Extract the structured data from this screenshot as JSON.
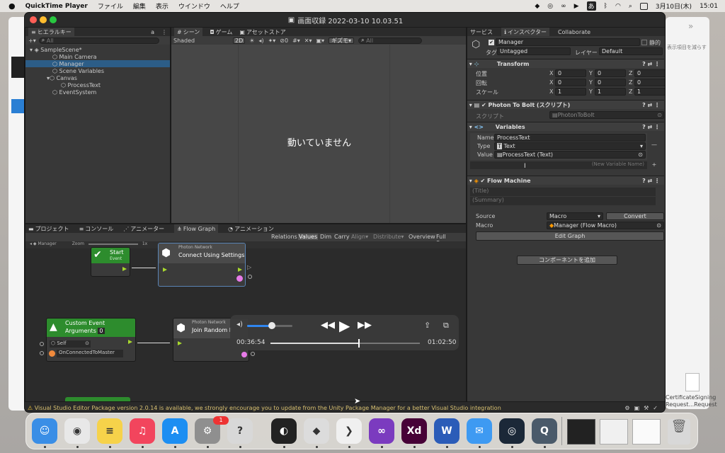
{
  "menubar": {
    "app": "QuickTime Player",
    "items": [
      "ファイル",
      "編集",
      "表示",
      "ウインドウ",
      "ヘルプ"
    ],
    "date": "3月10日(木)",
    "time": "15:01",
    "ime": "あ"
  },
  "window": {
    "title": "画面収録 2022-03-10 10.03.51"
  },
  "hierarchy": {
    "tab": "ヒエラルキー",
    "search_placeholder": "All",
    "items": [
      {
        "label": "SampleScene*"
      },
      {
        "label": "Main Camera"
      },
      {
        "label": "Manager"
      },
      {
        "label": "Scene Variables"
      },
      {
        "label": "Canvas"
      },
      {
        "label": "ProcessText"
      },
      {
        "label": "EventSystem"
      }
    ]
  },
  "scene": {
    "tabs": [
      "シーン",
      "ゲーム",
      "アセットストア"
    ],
    "shading": "Shaded",
    "mode2d": "2D",
    "gizmos": "ギズモ",
    "search_placeholder": "All",
    "overlay_text": "動いていません"
  },
  "bottom": {
    "tabs": [
      "プロジェクト",
      "コンソール",
      "アニメーター",
      "Flow Graph",
      "アニメーション"
    ],
    "toolbar": [
      "Relations",
      "Values",
      "Dim",
      "Carry",
      "Align",
      "Distribute",
      "Overview",
      "Full Screen"
    ],
    "breadcrumb": "Manager",
    "zoom_label": "Zoom",
    "zoom_value": "1x"
  },
  "graph": {
    "start_node": {
      "title": "Start",
      "subtitle": "Event"
    },
    "connect_node": {
      "category": "Photon Network",
      "title": "Connect Using Settings"
    },
    "custom_event_node": {
      "title": "Custom Event",
      "subtitle": "Arguments",
      "count": "0",
      "self": "Self",
      "event": "OnConnectedToMaster"
    },
    "join_node": {
      "category": "Photon Network",
      "title": "Join Random F"
    }
  },
  "quicktime": {
    "elapsed": "00:36:54",
    "remaining": "01:02:50",
    "volume": 0.55,
    "progress": 0.59
  },
  "inspector": {
    "tabs": [
      "サービス",
      "インスペクター",
      "Collaborate"
    ],
    "object_name": "Manager",
    "static_label": "静的",
    "tag_label": "タグ",
    "tag_value": "Untagged",
    "layer_label": "レイヤー",
    "layer_value": "Default",
    "transform": {
      "title": "Transform",
      "rows": [
        {
          "label": "位置",
          "x": "0",
          "y": "0",
          "z": "0"
        },
        {
          "label": "回転",
          "x": "0",
          "y": "0",
          "z": "0"
        },
        {
          "label": "スケール",
          "x": "1",
          "y": "1",
          "z": "1"
        }
      ],
      "x": "X",
      "y": "Y",
      "z": "Z"
    },
    "photon": {
      "title": "Photon To Bolt (スクリプト)",
      "script_label": "スクリプト",
      "script_value": "PhotonToBolt"
    },
    "variables": {
      "title": "Variables",
      "name_label": "Name",
      "name_value": "ProcessText",
      "type_label": "Type",
      "type_value": "Text",
      "value_label": "Value",
      "value_value": "ProcessText (Text)",
      "new_var_placeholder": "(New Variable Name)"
    },
    "flow": {
      "title": "Flow Machine",
      "title_placeholder": "(Title)",
      "summary_placeholder": "(Summary)",
      "source_label": "Source",
      "source_value": "Macro",
      "convert": "Convert",
      "macro_label": "Macro",
      "macro_value": "Manager (Flow Macro)",
      "edit_graph": "Edit Graph"
    },
    "add_component": "コンポーネントを追加"
  },
  "warning": "Visual Studio Editor Package version 2.0.14 is available, we strongly encourage you to update from the Unity Package Manager for a better Visual Studio integration",
  "right_bg": {
    "hint": "表示項目を減らす",
    "file_label1": "CertificateSigning",
    "file_label2": "Request...Request"
  },
  "dock": {
    "badge": "1",
    "apps": [
      {
        "name": "Finder",
        "color": "#3a8ee6",
        "glyph": "☺"
      },
      {
        "name": "Chrome",
        "color": "#e8e8e8",
        "glyph": "◉"
      },
      {
        "name": "Notes",
        "color": "#f6d24a",
        "glyph": "≡"
      },
      {
        "name": "Music",
        "color": "#f2455d",
        "glyph": "♫"
      },
      {
        "name": "App Store",
        "color": "#1c8ef2",
        "glyph": "A"
      },
      {
        "name": "System Preferences",
        "color": "#8f8f8f",
        "glyph": "⚙"
      },
      {
        "name": "Help",
        "color": "#d8d8d8",
        "glyph": "?"
      },
      {
        "name": "Webex",
        "color": "#222",
        "glyph": "◐"
      },
      {
        "name": "Unity",
        "color": "#dcdcdc",
        "glyph": "◆"
      },
      {
        "name": "VS Code",
        "color": "#f0f0f0",
        "glyph": "❯"
      },
      {
        "name": "Visual Studio",
        "color": "#7b3bbf",
        "glyph": "∞"
      },
      {
        "name": "Adobe XD",
        "color": "#470137",
        "glyph": "Xd"
      },
      {
        "name": "Word",
        "color": "#2b5cb8",
        "glyph": "W"
      },
      {
        "name": "Mail",
        "color": "#3e9af2",
        "glyph": "✉"
      },
      {
        "name": "Steam",
        "color": "#1b2838",
        "glyph": "◎"
      },
      {
        "name": "QuickTime",
        "color": "#4a5a6a",
        "glyph": "Q"
      }
    ]
  }
}
